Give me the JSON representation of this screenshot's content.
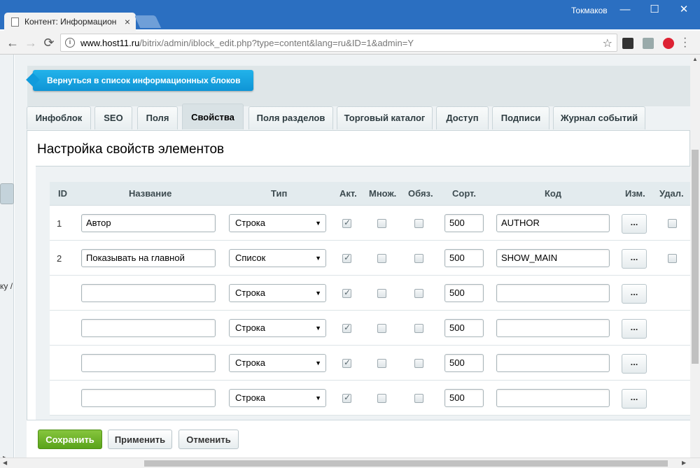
{
  "browser": {
    "tab_title": "Контент: Информацион",
    "tab_close": "×",
    "user": "Токмаков",
    "url_host": "www.host11.ru",
    "url_path": "/bitrix/admin/iblock_edit.php?type=content&lang=ru&ID=1&admin=Y",
    "nav_back": "←",
    "nav_forward": "→",
    "nav_reload": "⟳",
    "star": "☆",
    "win_min": "—",
    "win_max": "☐",
    "win_close": "✕"
  },
  "sidebar": {
    "breadcrumb_fragment": "ку /"
  },
  "back_button": "Вернуться в список информационных блоков",
  "tabs": [
    {
      "label": "Инфоблок"
    },
    {
      "label": "SEO"
    },
    {
      "label": "Поля"
    },
    {
      "label": "Свойства"
    },
    {
      "label": "Поля разделов"
    },
    {
      "label": "Торговый каталог"
    },
    {
      "label": "Доступ"
    },
    {
      "label": "Подписи"
    },
    {
      "label": "Журнал событий"
    }
  ],
  "active_tab": "Свойства",
  "section_title": "Настройка свойств элементов",
  "columns": {
    "id": "ID",
    "name": "Название",
    "type": "Тип",
    "active": "Акт.",
    "multiple": "Множ.",
    "required": "Обяз.",
    "sort": "Сорт.",
    "code": "Код",
    "edit": "Изм.",
    "delete": "Удал."
  },
  "rows": [
    {
      "id": "1",
      "name": "Автор",
      "type": "Строка",
      "active": true,
      "multiple": false,
      "required": false,
      "sort": "500",
      "code": "AUTHOR",
      "edit": "...",
      "has_delete": true
    },
    {
      "id": "2",
      "name": "Показывать на главной",
      "type": "Список",
      "active": true,
      "multiple": false,
      "required": false,
      "sort": "500",
      "code": "SHOW_MAIN",
      "edit": "...",
      "has_delete": true
    },
    {
      "id": "",
      "name": "",
      "type": "Строка",
      "active": true,
      "multiple": false,
      "required": false,
      "sort": "500",
      "code": "",
      "edit": "...",
      "has_delete": false
    },
    {
      "id": "",
      "name": "",
      "type": "Строка",
      "active": true,
      "multiple": false,
      "required": false,
      "sort": "500",
      "code": "",
      "edit": "...",
      "has_delete": false
    },
    {
      "id": "",
      "name": "",
      "type": "Строка",
      "active": true,
      "multiple": false,
      "required": false,
      "sort": "500",
      "code": "",
      "edit": "...",
      "has_delete": false
    },
    {
      "id": "",
      "name": "",
      "type": "Строка",
      "active": true,
      "multiple": false,
      "required": false,
      "sort": "500",
      "code": "",
      "edit": "...",
      "has_delete": false
    }
  ],
  "footer": {
    "save": "Сохранить",
    "apply": "Применить",
    "cancel": "Отменить"
  },
  "colors": {
    "titlebar": "#2b6fc1",
    "back_button": "#1aa7e4",
    "save_button": "#6cb12a"
  }
}
